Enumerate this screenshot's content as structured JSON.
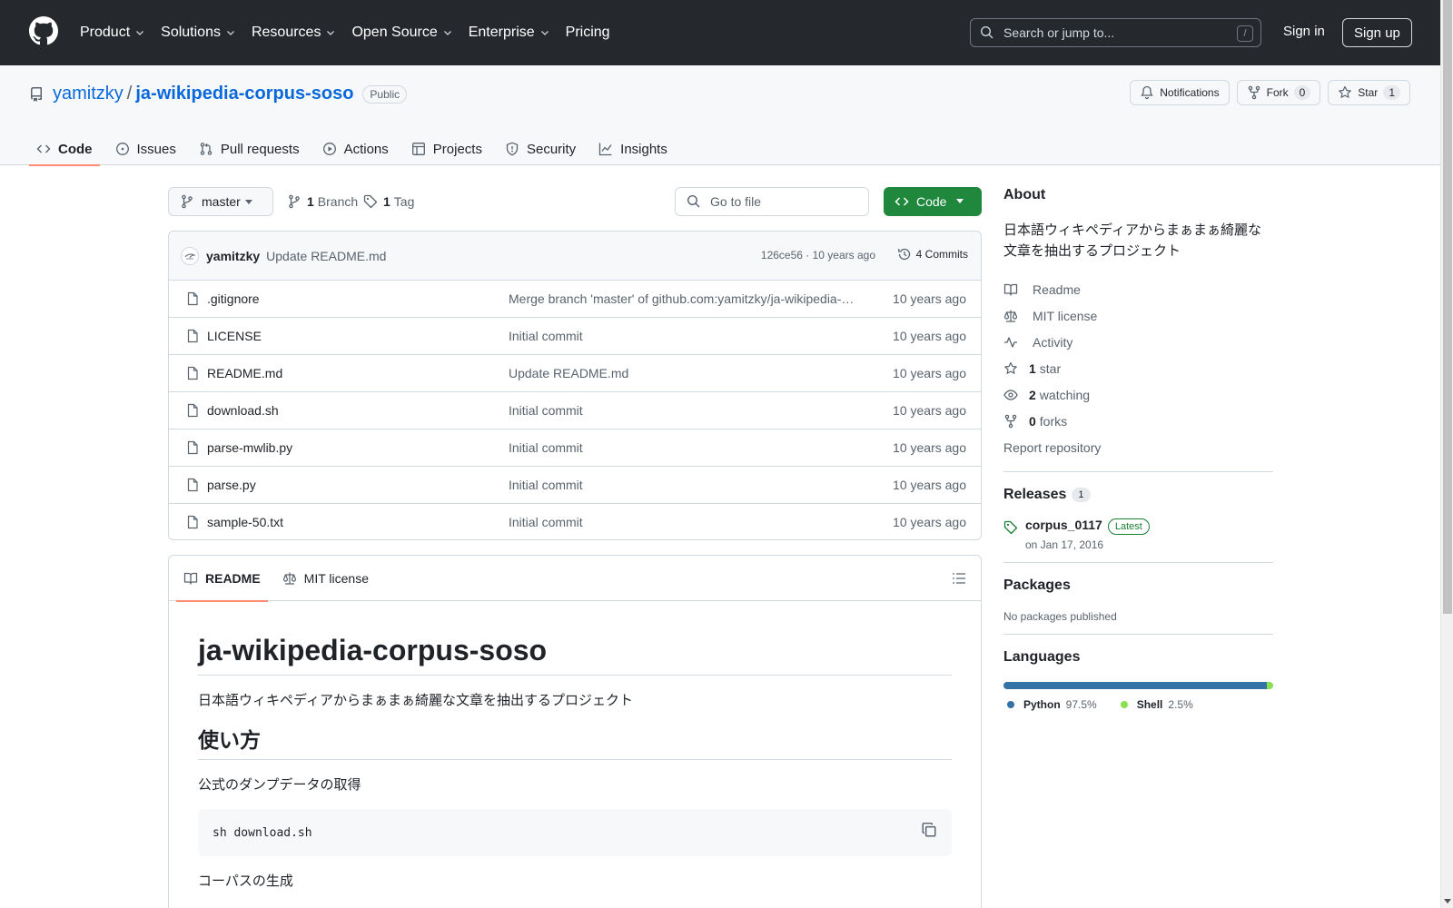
{
  "header": {
    "nav": [
      {
        "label": "Product",
        "has_menu": true
      },
      {
        "label": "Solutions",
        "has_menu": true
      },
      {
        "label": "Resources",
        "has_menu": true
      },
      {
        "label": "Open Source",
        "has_menu": true
      },
      {
        "label": "Enterprise",
        "has_menu": true
      },
      {
        "label": "Pricing",
        "has_menu": false
      }
    ],
    "search_placeholder": "Search or jump to...",
    "search_shortcut": "/",
    "sign_in": "Sign in",
    "sign_up": "Sign up"
  },
  "repo": {
    "owner": "yamitzky",
    "separator": "/",
    "name": "ja-wikipedia-corpus-soso",
    "visibility": "Public",
    "notifications_label": "Notifications",
    "fork_label": "Fork",
    "fork_count": "0",
    "star_label": "Star",
    "star_count": "1"
  },
  "tabs": [
    {
      "label": "Code",
      "icon": "code-icon",
      "active": true
    },
    {
      "label": "Issues",
      "icon": "issue-icon",
      "active": false
    },
    {
      "label": "Pull requests",
      "icon": "pull-request-icon",
      "active": false
    },
    {
      "label": "Actions",
      "icon": "play-icon",
      "active": false
    },
    {
      "label": "Projects",
      "icon": "table-icon",
      "active": false
    },
    {
      "label": "Security",
      "icon": "shield-icon",
      "active": false
    },
    {
      "label": "Insights",
      "icon": "graph-icon",
      "active": false
    }
  ],
  "toolbar": {
    "branch": "master",
    "branch_count": "1",
    "branch_label": "Branch",
    "tag_count": "1",
    "tag_label": "Tag",
    "goto_placeholder": "Go to file",
    "code_button": "Code"
  },
  "commit": {
    "author": "yamitzky",
    "message": "Update README.md",
    "sha_date": "126ce56 · 10 years ago",
    "count": "4 Commits"
  },
  "files": [
    {
      "name": ".gitignore",
      "message": "Merge branch 'master' of github.com:yamitzky/ja-wikipedia-…",
      "date": "10 years ago"
    },
    {
      "name": "LICENSE",
      "message": "Initial commit",
      "date": "10 years ago"
    },
    {
      "name": "README.md",
      "message": "Update README.md",
      "date": "10 years ago"
    },
    {
      "name": "download.sh",
      "message": "Initial commit",
      "date": "10 years ago"
    },
    {
      "name": "parse-mwlib.py",
      "message": "Initial commit",
      "date": "10 years ago"
    },
    {
      "name": "parse.py",
      "message": "Initial commit",
      "date": "10 years ago"
    },
    {
      "name": "sample-50.txt",
      "message": "Initial commit",
      "date": "10 years ago"
    }
  ],
  "readme": {
    "tab_readme": "README",
    "tab_license": "MIT license",
    "title": "ja-wikipedia-corpus-soso",
    "intro": "日本語ウィキペディアからまぁまぁ綺麗な文章を抽出するプロジェクト",
    "h2": "使い方",
    "step1": "公式のダンプデータの取得",
    "code1": "sh download.sh",
    "step2": "コーパスの生成"
  },
  "about": {
    "title": "About",
    "description": "日本語ウィキペディアからまぁまぁ綺麗な文章を抽出するプロジェクト",
    "links": [
      {
        "icon": "book-icon",
        "bold": "",
        "label": "Readme"
      },
      {
        "icon": "law-icon",
        "bold": "",
        "label": "MIT license"
      },
      {
        "icon": "pulse-icon",
        "bold": "",
        "label": "Activity"
      },
      {
        "icon": "star-icon",
        "bold": "1",
        "label": "star"
      },
      {
        "icon": "eye-icon",
        "bold": "2",
        "label": "watching"
      },
      {
        "icon": "fork-icon",
        "bold": "0",
        "label": "forks"
      }
    ],
    "report": "Report repository"
  },
  "releases": {
    "title": "Releases",
    "count": "1",
    "name": "corpus_0117",
    "badge": "Latest",
    "date": "on Jan 17, 2016"
  },
  "packages": {
    "title": "Packages",
    "empty": "No packages published"
  },
  "languages": {
    "title": "Languages",
    "items": [
      {
        "name": "Python",
        "percent": "97.5%",
        "share": 97.5,
        "color": "#3572A5"
      },
      {
        "name": "Shell",
        "percent": "2.5%",
        "share": 2.5,
        "color": "#89e051"
      }
    ]
  }
}
